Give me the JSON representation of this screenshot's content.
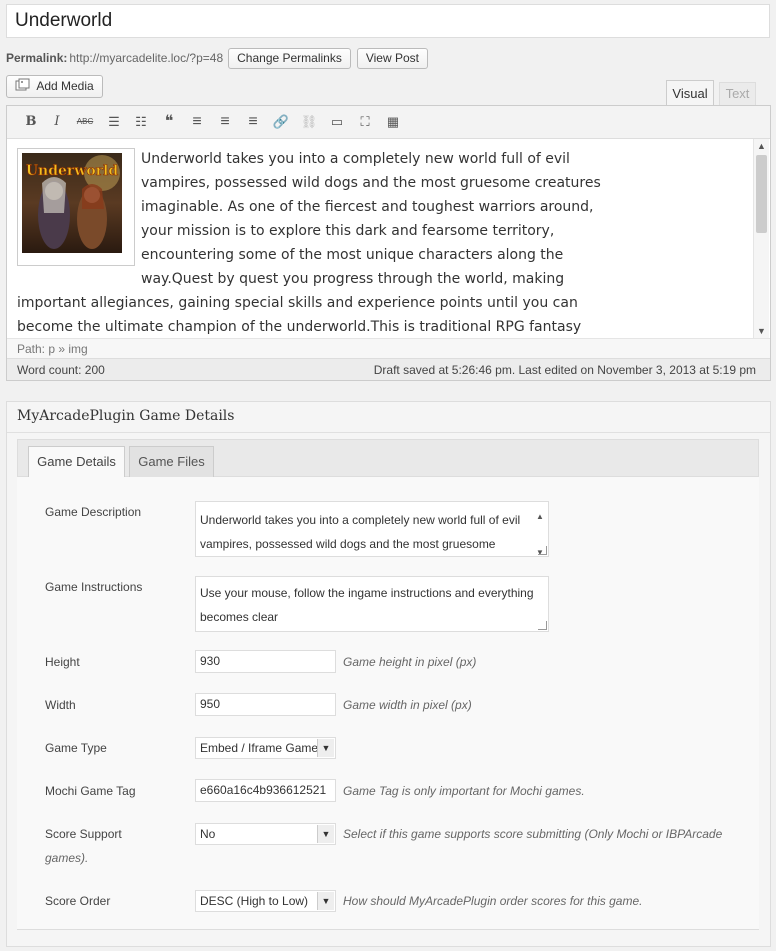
{
  "post": {
    "title": "Underworld",
    "permalink_label": "Permalink:",
    "permalink_url": "http://myarcadelite.loc/?p=48",
    "change_permalinks_label": "Change Permalinks",
    "view_post_label": "View Post"
  },
  "editor": {
    "add_media_label": "Add Media",
    "tabs": {
      "visual": "Visual",
      "text": "Text"
    },
    "toolbar": [
      {
        "icon": "bold-icon",
        "glyph": "B"
      },
      {
        "icon": "italic-icon",
        "glyph": "I"
      },
      {
        "icon": "strikethrough-icon",
        "glyph": "ABC"
      },
      {
        "icon": "bullet-list-icon",
        "glyph": "☰"
      },
      {
        "icon": "numbered-list-icon",
        "glyph": "☷"
      },
      {
        "icon": "blockquote-icon",
        "glyph": "❝"
      },
      {
        "icon": "align-left-icon",
        "glyph": "≡"
      },
      {
        "icon": "align-center-icon",
        "glyph": "≡"
      },
      {
        "icon": "align-right-icon",
        "glyph": "≡"
      },
      {
        "icon": "link-icon",
        "glyph": "🔗"
      },
      {
        "icon": "unlink-icon",
        "glyph": "⛓"
      },
      {
        "icon": "more-tag-icon",
        "glyph": "▭"
      },
      {
        "icon": "fullscreen-icon",
        "glyph": "⛶"
      },
      {
        "icon": "kitchen-sink-icon",
        "glyph": "▦"
      }
    ],
    "image_alt": "Underworld",
    "content": "Underworld takes you into a completely new world full of evil vampires, possessed wild dogs and the most gruesome creatures imaginable. As one of the fiercest and toughest warriors around, your mission is to explore this dark and fearsome territory, encountering some of the most unique characters along the way.Quest by quest you progress through the world, making important allegiances, gaining special skills and experience points until you can become the ultimate champion of the underworld.This is traditional RPG fantasy gaming at its very best and appeals to old and new gamers alike. It has a huge amount of",
    "path": "Path: p » img",
    "word_count": "Word count: 200",
    "draft_status": "Draft saved at 5:26:46 pm. Last edited on November 3, 2013 at 5:19 pm"
  },
  "metabox": {
    "title": "MyArcadePlugin Game Details",
    "tabs": [
      "Game Details",
      "Game Files"
    ],
    "fields": {
      "description": {
        "label": "Game Description",
        "value": "Underworld takes you into a completely new world full of evil vampires, possessed wild dogs and the most gruesome"
      },
      "instructions": {
        "label": "Game Instructions",
        "value": "Use your mouse, follow the ingame instructions and everything becomes clear"
      },
      "height": {
        "label": "Height",
        "value": "930",
        "hint": "Game height in pixel (px)"
      },
      "width": {
        "label": "Width",
        "value": "950",
        "hint": "Game width in pixel (px)"
      },
      "game_type": {
        "label": "Game Type",
        "value": "Embed / Iframe Game"
      },
      "mochi_tag": {
        "label": "Mochi Game Tag",
        "value": "e660a16c4b936612521",
        "hint": "Game Tag is only important for Mochi games."
      },
      "score_support": {
        "label": "Score Support",
        "value": "No",
        "hint_line1": "Select if this game supports score submitting (Only Mochi or IBPArcade",
        "hint_line2": "games)."
      },
      "score_order": {
        "label": "Score Order",
        "value": "DESC (High to Low)",
        "hint": "How should MyArcadePlugin order scores for this game."
      }
    }
  }
}
